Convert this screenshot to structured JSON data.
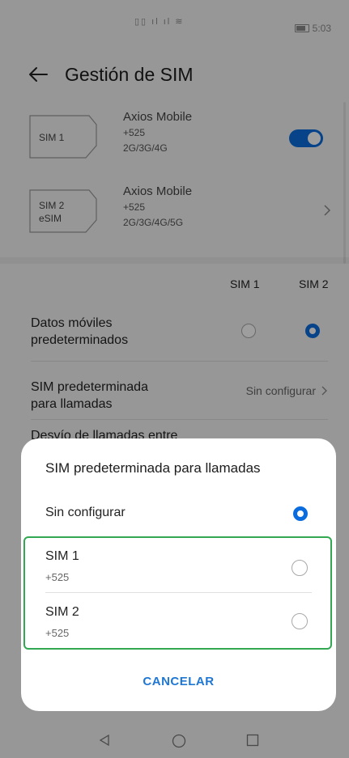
{
  "status_bar": {
    "carrier_glyph": "▯▯ ıl ıl ≋",
    "time": "5:03"
  },
  "header": {
    "title": "Gestión de SIM"
  },
  "sims": [
    {
      "card_label": "SIM 1",
      "card_sub": "",
      "name": "Axios Mobile",
      "number": "+525",
      "network": "2G/3G/4G"
    },
    {
      "card_label": "SIM 2",
      "card_sub": "eSIM",
      "name": "Axios Mobile",
      "number": "+525",
      "network": "2G/3G/4G/5G"
    }
  ],
  "columns": {
    "sim1": "SIM 1",
    "sim2": "SIM 2"
  },
  "settings": {
    "mobile_data_line1": "Datos móviles",
    "mobile_data_line2": "predeterminados",
    "calls_line1": "SIM predeterminada",
    "calls_line2": "para llamadas",
    "calls_value": "Sin configurar",
    "forward_partial": "Desvío de llamadas entre"
  },
  "dialog": {
    "title": "SIM predeterminada para llamadas",
    "options": [
      {
        "label": "Sin configurar",
        "sub": "",
        "selected": true
      },
      {
        "label": "SIM 1",
        "sub": "+525",
        "selected": false
      },
      {
        "label": "SIM 2",
        "sub": "+525",
        "selected": false
      }
    ],
    "cancel": "CANCELAR"
  },
  "colors": {
    "accent": "#0a6cde",
    "highlight": "#32a852",
    "button_text": "#1f77d4"
  }
}
